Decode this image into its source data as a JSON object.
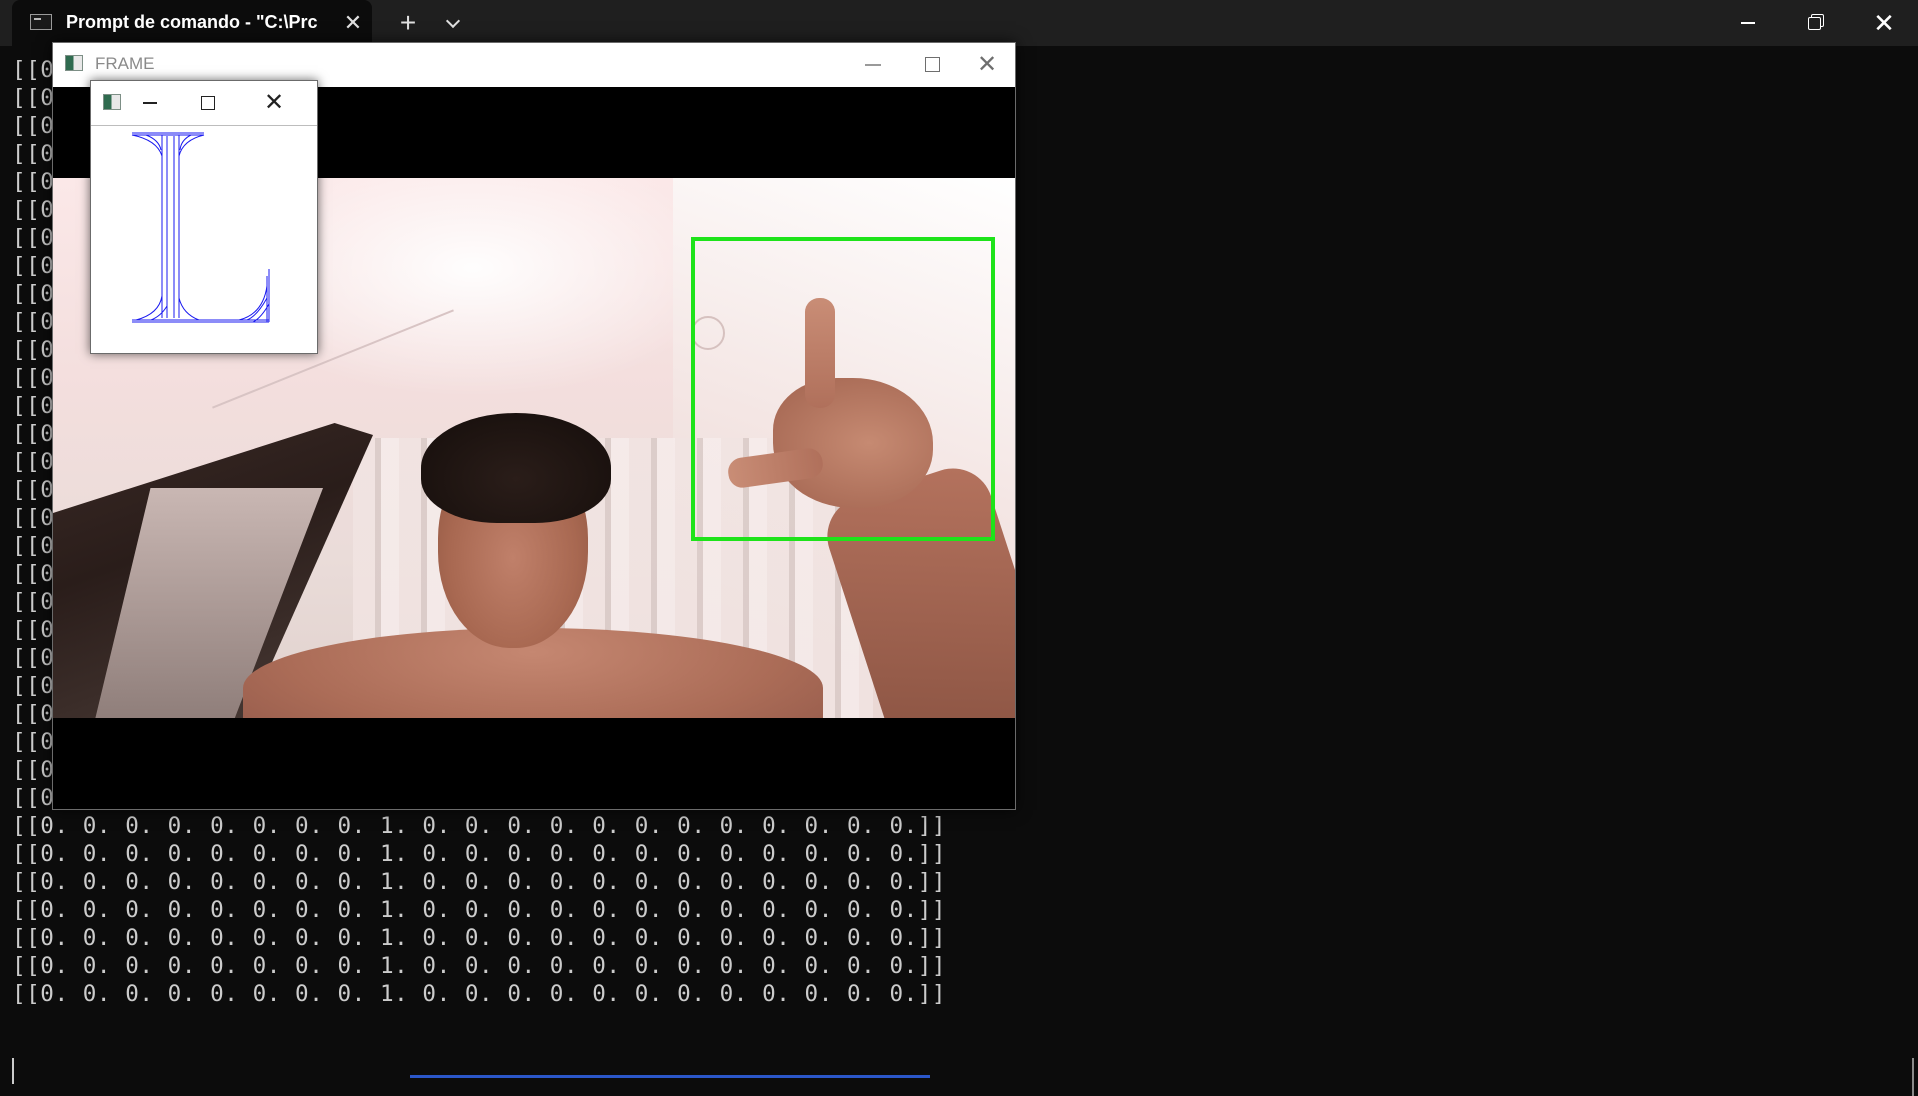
{
  "terminal": {
    "tab_title": "Prompt de comando - \"C:\\Prc",
    "tab_close": "✕",
    "new_tab": "+",
    "icons": {
      "tab": "terminal-icon",
      "dropdown": "chevron-down-icon",
      "minimize": "minimize-icon",
      "restore": "restore-icon",
      "close": "close-icon"
    },
    "window_close": "✕",
    "lines_hidden": [
      "[[0",
      "[[0",
      "[[0",
      "[[0",
      "[[0",
      "[[0",
      "[[0",
      "[[0",
      "[[0",
      "[[0",
      "[[0",
      "[[0",
      "[[0",
      "[[0",
      "[[0",
      "[[0",
      "[[0",
      "[[0",
      "[[0",
      "[[0",
      "[[0",
      "[[0",
      "[[0",
      "[[0",
      "[[0",
      "[[0",
      "[[0"
    ],
    "lines_full": [
      "[[0. 0. 0. 0. 0. 0. 0. 0. 1. 0. 0. 0. 0. 0. 0. 0. 0. 0. 0. 0. 0.]]",
      "[[0. 0. 0. 0. 0. 0. 0. 0. 1. 0. 0. 0. 0. 0. 0. 0. 0. 0. 0. 0. 0.]]",
      "[[0. 0. 0. 0. 0. 0. 0. 0. 1. 0. 0. 0. 0. 0. 0. 0. 0. 0. 0. 0. 0.]]",
      "[[0. 0. 0. 0. 0. 0. 0. 0. 1. 0. 0. 0. 0. 0. 0. 0. 0. 0. 0. 0. 0.]]",
      "[[0. 0. 0. 0. 0. 0. 0. 0. 1. 0. 0. 0. 0. 0. 0. 0. 0. 0. 0. 0. 0.]]",
      "[[0. 0. 0. 0. 0. 0. 0. 0. 1. 0. 0. 0. 0. 0. 0. 0. 0. 0. 0. 0. 0.]]",
      "[[0. 0. 0. 0. 0. 0. 0. 0. 1. 0. 0. 0. 0. 0. 0. 0. 0. 0. 0. 0. 0.]]"
    ]
  },
  "frame_window": {
    "title": "FRAME",
    "close": "✕",
    "roi_color": "#1ee31a"
  },
  "prediction_window": {
    "close": "✕",
    "letter_color": "#1a1af0"
  }
}
